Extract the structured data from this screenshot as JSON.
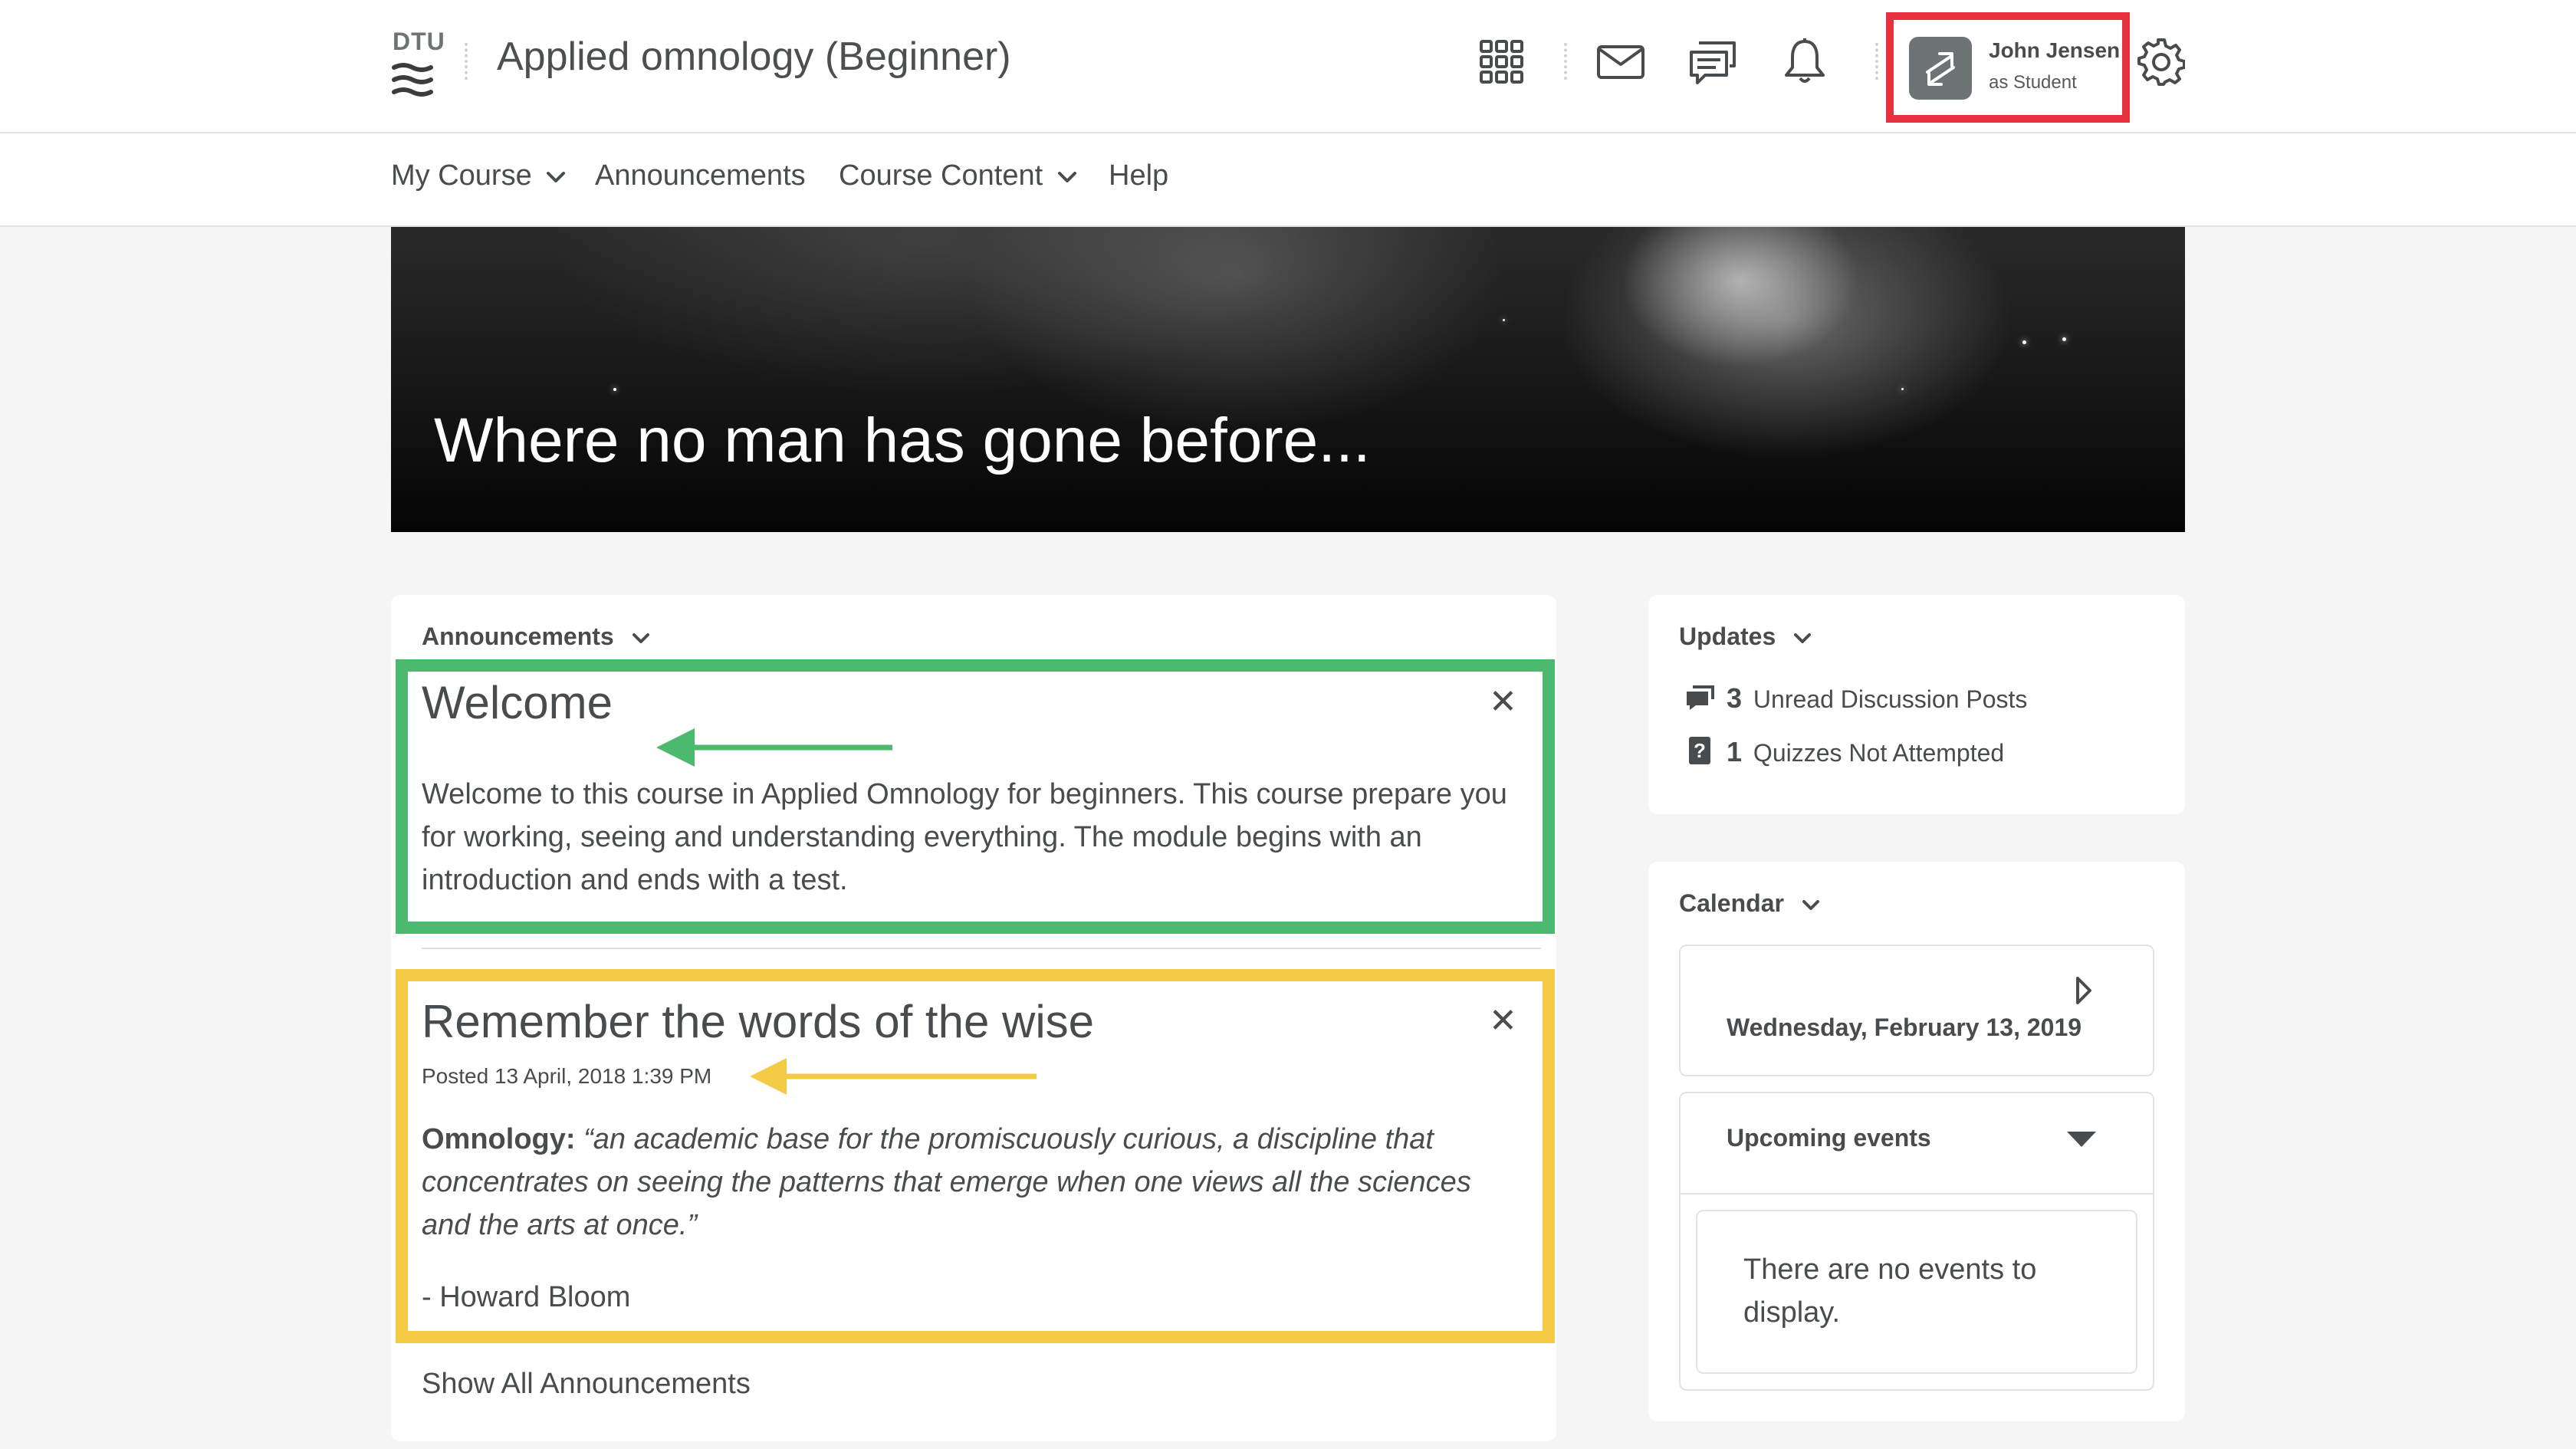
{
  "header": {
    "logo_text": "DTU",
    "course_title": "Applied omnology (Beginner)",
    "user": {
      "name": "John Jensen",
      "role": "as Student"
    }
  },
  "nav": {
    "items": [
      {
        "label": "My Course",
        "dropdown": true
      },
      {
        "label": "Announcements",
        "dropdown": false
      },
      {
        "label": "Course Content",
        "dropdown": true
      },
      {
        "label": "Help",
        "dropdown": false
      }
    ]
  },
  "banner": {
    "title": "Where no man has gone before..."
  },
  "announcements": {
    "heading": "Announcements",
    "items": [
      {
        "title": "Welcome",
        "body": "Welcome to this course in Applied Omnology for beginners. This course prepare you for working, seeing and understanding everything. The module begins with an introduction and ends with a test."
      },
      {
        "title": "Remember the words of the wise",
        "posted": "Posted 13 April, 2018 1:39 PM",
        "quote_label": "Omnology:",
        "quote_text": "“an academic base for the promiscuously curious, a discipline that concentrates on seeing the patterns that emerge when one views all the sciences and the arts at once.”",
        "attribution": "- Howard Bloom"
      }
    ],
    "show_all": "Show All Announcements"
  },
  "updates": {
    "heading": "Updates",
    "rows": [
      {
        "count": "3",
        "label": "Unread Discussion Posts",
        "icon": "discussion-icon"
      },
      {
        "count": "1",
        "label": "Quizzes Not Attempted",
        "icon": "quiz-icon"
      }
    ]
  },
  "calendar": {
    "heading": "Calendar",
    "date": "Wednesday, February 13, 2019",
    "upcoming_label": "Upcoming events",
    "empty_text": "There are no events to display."
  },
  "colors": {
    "highlight_user": "#e8303f",
    "highlight_welcome": "#4bb96e",
    "highlight_wise": "#f4cb45",
    "arrow_green": "#4bb96e",
    "arrow_yellow": "#f4cb45"
  }
}
